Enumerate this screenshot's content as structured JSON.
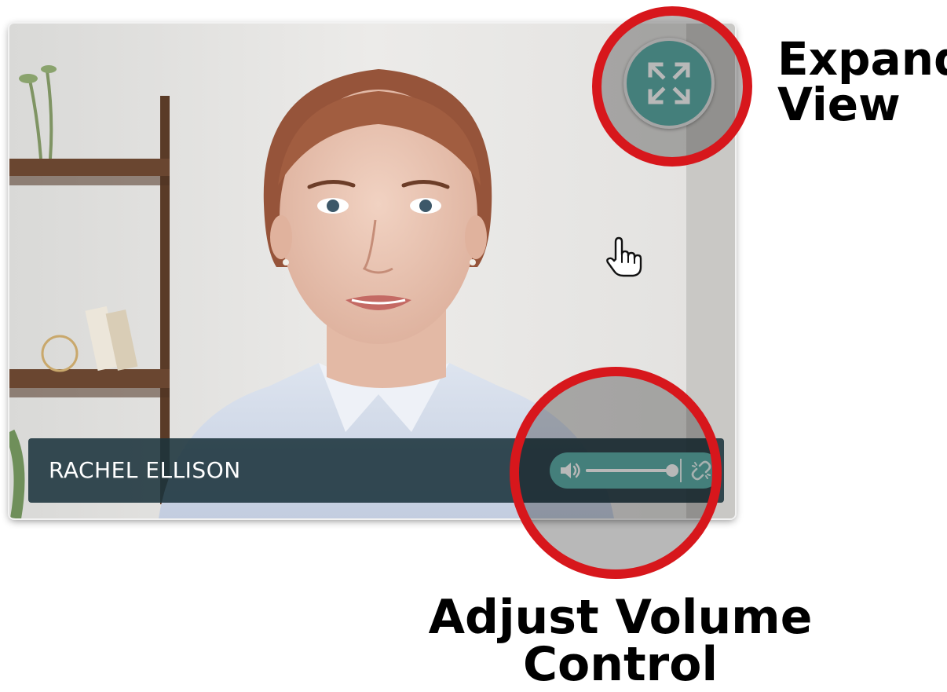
{
  "video_tile": {
    "participant_name": "RACHEL ELLISON",
    "volume_level_percent": 100,
    "icons": {
      "expand": "expand-arrows-icon",
      "volume": "speaker-icon",
      "unlink": "unlink-icon",
      "cursor": "pointer-hand-icon"
    }
  },
  "callouts": {
    "expand_line1": "Expand",
    "expand_line2": "View",
    "volume_line1": "Adjust Volume",
    "volume_line2": "Control"
  },
  "colors": {
    "accent_teal": "#5fb1ab",
    "name_bar": "#1b333c",
    "highlight_ring": "#d7171c",
    "white": "#ffffff"
  }
}
